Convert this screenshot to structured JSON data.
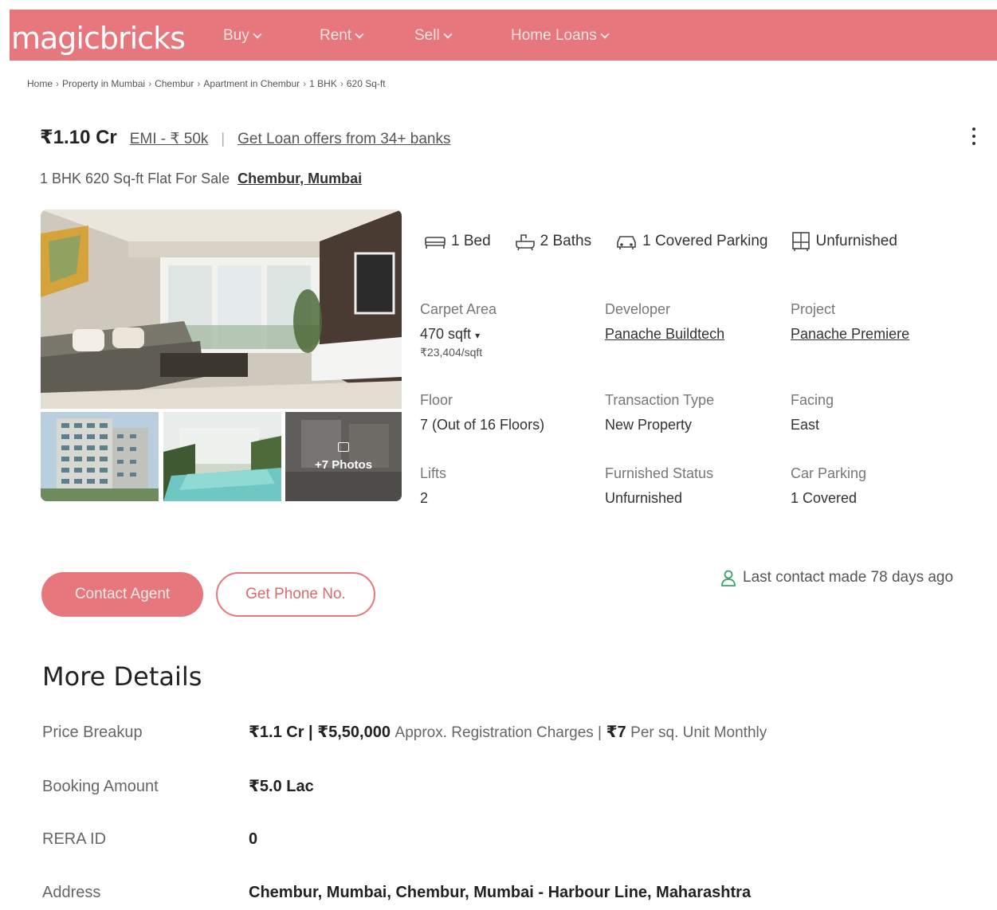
{
  "header": {
    "logo": "magicbricks",
    "nav": [
      {
        "label": "Buy"
      },
      {
        "label": "Rent"
      },
      {
        "label": "Sell"
      },
      {
        "label": "Home Loans"
      }
    ]
  },
  "breadcrumb": [
    "Home",
    "Property in Mumbai",
    "Chembur",
    "Apartment in Chembur",
    "1 BHK",
    "620 Sq-ft"
  ],
  "listing": {
    "price": "₹1.10 Cr",
    "emi": "EMI - ₹ 50k",
    "loan_offers": "Get Loan offers from 34+ banks",
    "title": "1 BHK 620 Sq-ft Flat For Sale",
    "location": "Chembur, Mumbai",
    "photos_more": "+7 Photos"
  },
  "amenities": {
    "bed": "1 Bed",
    "baths": "2 Baths",
    "parking": "1 Covered Parking",
    "furnishing": "Unfurnished"
  },
  "specs": {
    "carpet_area_label": "Carpet Area",
    "carpet_area_value": "470 sqft",
    "carpet_area_rate": "₹23,404/sqft",
    "developer_label": "Developer",
    "developer_value": "Panache Buildtech",
    "project_label": "Project",
    "project_value": "Panache Premiere",
    "floor_label": "Floor",
    "floor_value": "7 (Out of 16 Floors)",
    "transaction_label": "Transaction Type",
    "transaction_value": "New Property",
    "facing_label": "Facing",
    "facing_value": "East",
    "lifts_label": "Lifts",
    "lifts_value": "2",
    "furnished_label": "Furnished Status",
    "furnished_value": "Unfurnished",
    "car_parking_label": "Car Parking",
    "car_parking_value": "1 Covered"
  },
  "actions": {
    "contact_agent": "Contact Agent",
    "get_phone": "Get Phone No.",
    "last_contact": "Last contact made 78 days ago"
  },
  "more_details": {
    "title": "More Details",
    "price_breakup_label": "Price Breakup",
    "price_breakup_price": "₹1.1 Cr | ₹5,50,000",
    "price_breakup_reg": "Approx. Registration Charges |",
    "price_breakup_maint": "₹7",
    "price_breakup_unit": "Per sq. Unit Monthly",
    "booking_label": "Booking Amount",
    "booking_value": "₹5.0 Lac",
    "rera_label": "RERA ID",
    "rera_value": "0",
    "address_label": "Address",
    "address_value": "Chembur, Mumbai, Chembur, Mumbai - Harbour Line, Maharashtra"
  },
  "colors": {
    "brand": "#e5777d",
    "text": "#303030"
  }
}
